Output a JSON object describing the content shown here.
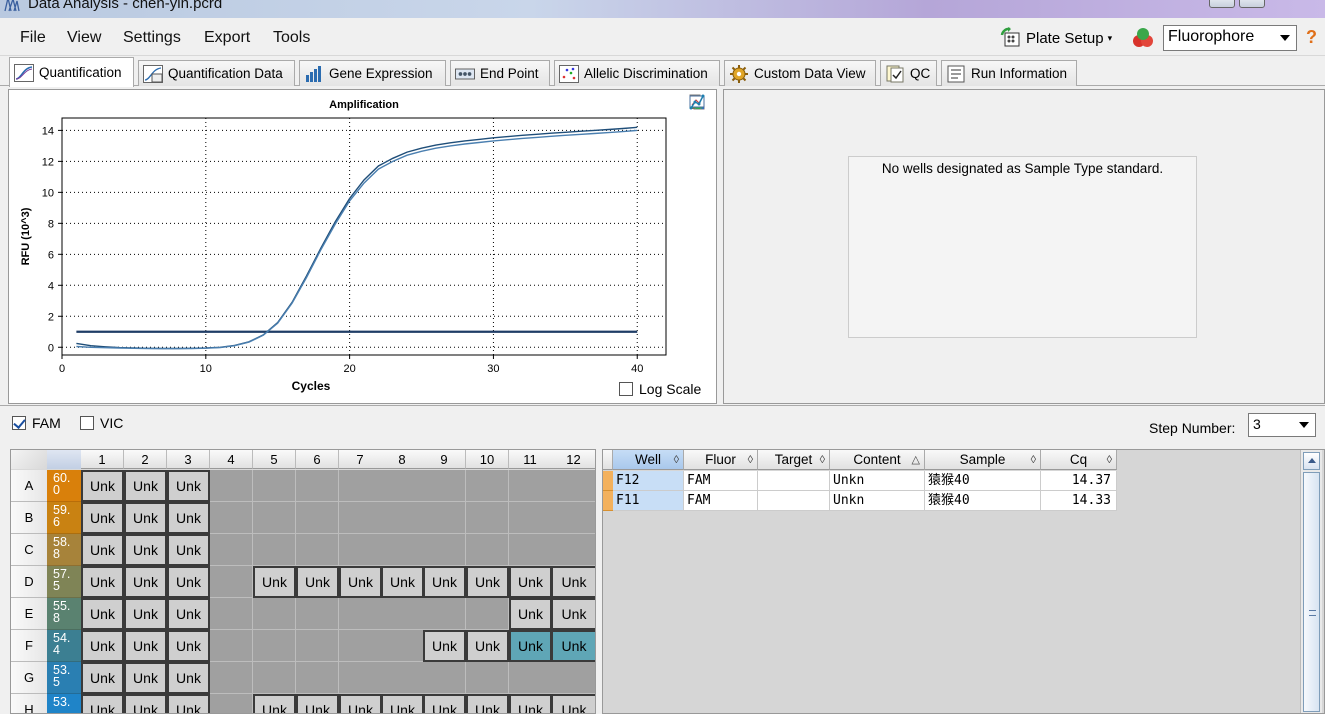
{
  "window": {
    "title": "Data Analysis - chen-yin.pcrd"
  },
  "menu": [
    {
      "label": "File",
      "key": "file"
    },
    {
      "label": "View",
      "key": "view"
    },
    {
      "label": "Settings",
      "key": "settings"
    },
    {
      "label": "Export",
      "key": "export"
    },
    {
      "label": "Tools",
      "key": "tools"
    }
  ],
  "toolbar": {
    "plate_setup_label": "Plate Setup",
    "fluorophore_selected": "Fluorophore",
    "help_glyph": "?"
  },
  "tabs": [
    {
      "label": "Quantification",
      "active": true,
      "icon": "amplification-icon"
    },
    {
      "label": "Quantification Data",
      "active": false,
      "icon": "data-sheet-icon"
    },
    {
      "label": "Gene Expression",
      "active": false,
      "icon": "bar-chart-icon"
    },
    {
      "label": "End Point",
      "active": false,
      "icon": "end-point-icon"
    },
    {
      "label": "Allelic Discrimination",
      "active": false,
      "icon": "scatter-icon"
    },
    {
      "label": "Custom Data View",
      "active": false,
      "icon": "gear-icon"
    },
    {
      "label": "QC",
      "active": false,
      "icon": "qc-check-icon"
    },
    {
      "label": "Run Information",
      "active": false,
      "icon": "info-list-icon"
    }
  ],
  "chart_data": {
    "type": "line",
    "title": "Amplification",
    "xlabel": "Cycles",
    "ylabel": "RFU (10^3)",
    "xlim": [
      0,
      42
    ],
    "ylim": [
      -0.5,
      14.8
    ],
    "xticks": [
      0,
      10,
      20,
      30,
      40
    ],
    "yticks": [
      0,
      2,
      4,
      6,
      8,
      10,
      12,
      14
    ],
    "grid": true,
    "threshold": 1.0,
    "series": [
      {
        "color": "#1f4e79",
        "x": [
          1,
          2,
          3,
          4,
          5,
          6,
          7,
          8,
          9,
          10,
          11,
          12,
          13,
          14,
          15,
          16,
          17,
          18,
          19,
          20,
          21,
          22,
          23,
          24,
          25,
          26,
          27,
          28,
          29,
          30,
          31,
          32,
          33,
          34,
          35,
          36,
          37,
          38,
          39,
          40
        ],
        "y": [
          0.25,
          0.1,
          0.03,
          -0.02,
          -0.05,
          -0.07,
          -0.08,
          -0.08,
          -0.07,
          -0.05,
          0.0,
          0.12,
          0.35,
          0.8,
          1.6,
          2.9,
          4.6,
          6.4,
          8.1,
          9.6,
          10.8,
          11.7,
          12.2,
          12.6,
          12.85,
          13.05,
          13.2,
          13.32,
          13.42,
          13.52,
          13.6,
          13.68,
          13.75,
          13.82,
          13.88,
          13.94,
          14.0,
          14.06,
          14.12,
          14.2
        ]
      },
      {
        "color": "#4a7fb0",
        "x": [
          1,
          2,
          3,
          4,
          5,
          6,
          7,
          8,
          9,
          10,
          11,
          12,
          13,
          14,
          15,
          16,
          17,
          18,
          19,
          20,
          21,
          22,
          23,
          24,
          25,
          26,
          27,
          28,
          29,
          30,
          31,
          32,
          33,
          34,
          35,
          36,
          37,
          38,
          39,
          40
        ],
        "y": [
          0.05,
          0.0,
          -0.03,
          -0.05,
          -0.07,
          -0.08,
          -0.09,
          -0.09,
          -0.08,
          -0.06,
          -0.02,
          0.1,
          0.33,
          0.78,
          1.55,
          2.85,
          4.5,
          6.3,
          7.95,
          9.45,
          10.6,
          11.5,
          12.0,
          12.4,
          12.65,
          12.85,
          13.0,
          13.12,
          13.22,
          13.32,
          13.4,
          13.48,
          13.55,
          13.62,
          13.68,
          13.74,
          13.8,
          13.86,
          13.92,
          14.0
        ]
      }
    ]
  },
  "chart_options": {
    "log_scale_label": "Log Scale",
    "log_scale_checked": false
  },
  "standard_panel": {
    "message": "No wells designated as Sample Type standard."
  },
  "filters": [
    {
      "label": "FAM",
      "checked": true
    },
    {
      "label": "VIC",
      "checked": false
    }
  ],
  "step": {
    "label": "Step Number:",
    "value": "3"
  },
  "plate": {
    "columns": [
      "1",
      "2",
      "3",
      "4",
      "5",
      "6",
      "7",
      "8",
      "9",
      "10",
      "11",
      "12"
    ],
    "rows": [
      {
        "label": "A",
        "temp_line1": "60.",
        "temp_line2": "0",
        "temp_color": "#d9800b",
        "wells": [
          "Unk",
          "Unk",
          "Unk",
          "",
          "",
          "",
          "",
          "",
          "",
          "",
          "",
          ""
        ]
      },
      {
        "label": "B",
        "temp_line1": "59.",
        "temp_line2": "6",
        "temp_color": "#c98212",
        "wells": [
          "Unk",
          "Unk",
          "Unk",
          "",
          "",
          "",
          "",
          "",
          "",
          "",
          "",
          ""
        ]
      },
      {
        "label": "C",
        "temp_line1": "58.",
        "temp_line2": "8",
        "temp_color": "#a7833a",
        "wells": [
          "Unk",
          "Unk",
          "Unk",
          "",
          "",
          "",
          "",
          "",
          "",
          "",
          "",
          ""
        ]
      },
      {
        "label": "D",
        "temp_line1": "57.",
        "temp_line2": "5",
        "temp_color": "#7f8456",
        "wells": [
          "Unk",
          "Unk",
          "Unk",
          "",
          "Unk",
          "Unk",
          "Unk",
          "Unk",
          "Unk",
          "Unk",
          "Unk",
          "Unk"
        ]
      },
      {
        "label": "E",
        "temp_line1": "55.",
        "temp_line2": "8",
        "temp_color": "#5a8270",
        "wells": [
          "Unk",
          "Unk",
          "Unk",
          "",
          "",
          "",
          "",
          "",
          "",
          "",
          "Unk",
          "Unk"
        ]
      },
      {
        "label": "F",
        "temp_line1": "54.",
        "temp_line2": "4",
        "temp_color": "#3c7f92",
        "wells": [
          "Unk",
          "Unk",
          "Unk",
          "",
          "",
          "",
          "",
          "",
          "Unk",
          "Unk",
          "Unk",
          "Unk"
        ],
        "selected": [
          10,
          11
        ]
      },
      {
        "label": "G",
        "temp_line1": "53.",
        "temp_line2": "5",
        "temp_color": "#2a7fb2",
        "wells": [
          "Unk",
          "Unk",
          "Unk",
          "",
          "",
          "",
          "",
          "",
          "",
          "",
          "",
          ""
        ]
      },
      {
        "label": "H",
        "temp_line1": "53.",
        "temp_line2": "",
        "temp_color": "#1f84c8",
        "wells": [
          "Unk",
          "Unk",
          "Unk",
          "",
          "Unk",
          "Unk",
          "Unk",
          "Unk",
          "Unk",
          "Unk",
          "Unk",
          "Unk"
        ]
      }
    ]
  },
  "results": {
    "columns": [
      "Well",
      "Fluor",
      "Target",
      "Content",
      "Sample",
      "Cq"
    ],
    "sort_marks": [
      "◊",
      "◊",
      "◊",
      "△",
      "◊",
      "◊"
    ],
    "rows": [
      {
        "well": "F12",
        "fluor": "FAM",
        "target": "",
        "content": "Unkn",
        "sample": "猿猴40",
        "cq": "14.37"
      },
      {
        "well": "F11",
        "fluor": "FAM",
        "target": "",
        "content": "Unkn",
        "sample": "猿猴40",
        "cq": "14.33"
      }
    ]
  }
}
